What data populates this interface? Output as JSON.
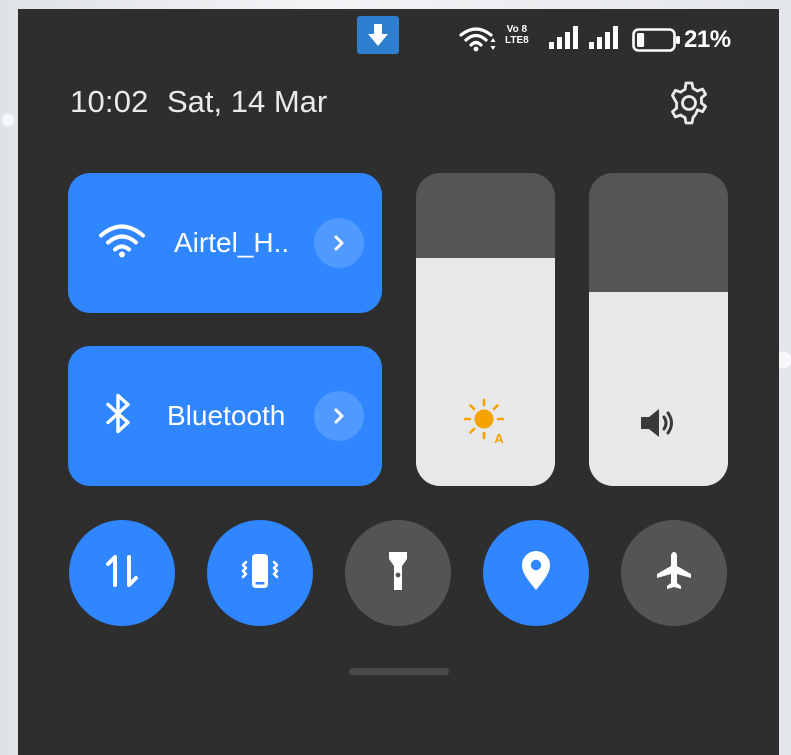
{
  "status_bar": {
    "volte_top": "Vo 8",
    "volte_bottom": "LTE8",
    "battery_percent": "21%",
    "battery_level": 0.21
  },
  "header": {
    "time": "10:02",
    "date": "Sat, 14 Mar"
  },
  "tiles": {
    "wifi": {
      "label": "Airtel_H..",
      "state": "on"
    },
    "bluetooth": {
      "label": "Bluetooth",
      "state": "on"
    }
  },
  "sliders": {
    "brightness": {
      "level": 0.73,
      "mode": "auto",
      "icon": "auto-brightness-icon",
      "badge": "A"
    },
    "volume": {
      "level": 0.62,
      "icon": "volume-icon"
    }
  },
  "toggles": [
    {
      "name": "mobile-data",
      "state": "on"
    },
    {
      "name": "vibrate",
      "state": "on"
    },
    {
      "name": "flashlight",
      "state": "off"
    },
    {
      "name": "location",
      "state": "on"
    },
    {
      "name": "airplane-mode",
      "state": "off"
    }
  ],
  "colors": {
    "accent": "#2f86ff",
    "panel": "#2e2e2e",
    "toggle_off": "#545454",
    "download_badge": "#2f7fd1",
    "sun": "#f4a300"
  }
}
